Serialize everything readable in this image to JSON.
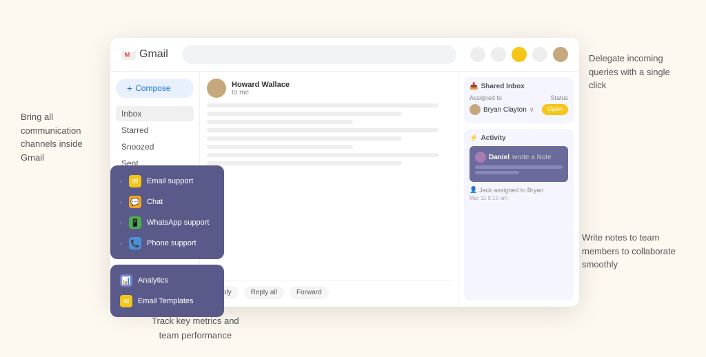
{
  "left_annotation": {
    "text": "Bring all communication channels inside Gmail"
  },
  "right_top_annotation": {
    "text": "Delegate incoming queries with a single click"
  },
  "right_bottom_annotation": {
    "text": "Write notes to team members to collaborate smoothly"
  },
  "bottom_annotation": {
    "text": "Track key metrics and\nteam performance"
  },
  "gmail_header": {
    "logo_text": "Gmail",
    "search_placeholder": ""
  },
  "gmail_sidebar": {
    "compose_label": "Compose",
    "items": [
      {
        "label": "Inbox"
      },
      {
        "label": "Starred"
      },
      {
        "label": "Snoozed"
      },
      {
        "label": "Sent"
      }
    ]
  },
  "email": {
    "sender": "Howard Wallace",
    "subtitle": "to me",
    "actions": [
      {
        "label": "Reply"
      },
      {
        "label": "Reply all"
      },
      {
        "label": "Forward"
      }
    ]
  },
  "shared_inbox": {
    "title": "Shared Inbox",
    "assigned_label": "Assigned to",
    "status_label": "Status",
    "user_name": "Bryan Clayton",
    "status_text": "Open"
  },
  "activity": {
    "title": "Activity",
    "note_author": "Daniel",
    "note_text": "wrote a Note",
    "assign_text": "Jack assigned to Bryan",
    "date_text": "Mar 11 9:15 am"
  },
  "features": {
    "group1": [
      {
        "icon": "✉",
        "icon_color": "yellow",
        "label": "Email support"
      },
      {
        "icon": "💬",
        "icon_color": "orange",
        "label": "Chat"
      },
      {
        "icon": "📱",
        "icon_color": "green",
        "label": "WhatsApp support"
      },
      {
        "icon": "📞",
        "icon_color": "blue",
        "label": "Phone support"
      }
    ],
    "group2": [
      {
        "icon": "📊",
        "icon_color": "purple",
        "label": "Analytics"
      },
      {
        "icon": "✉",
        "icon_color": "yellow",
        "label": "Email Templates"
      }
    ]
  }
}
